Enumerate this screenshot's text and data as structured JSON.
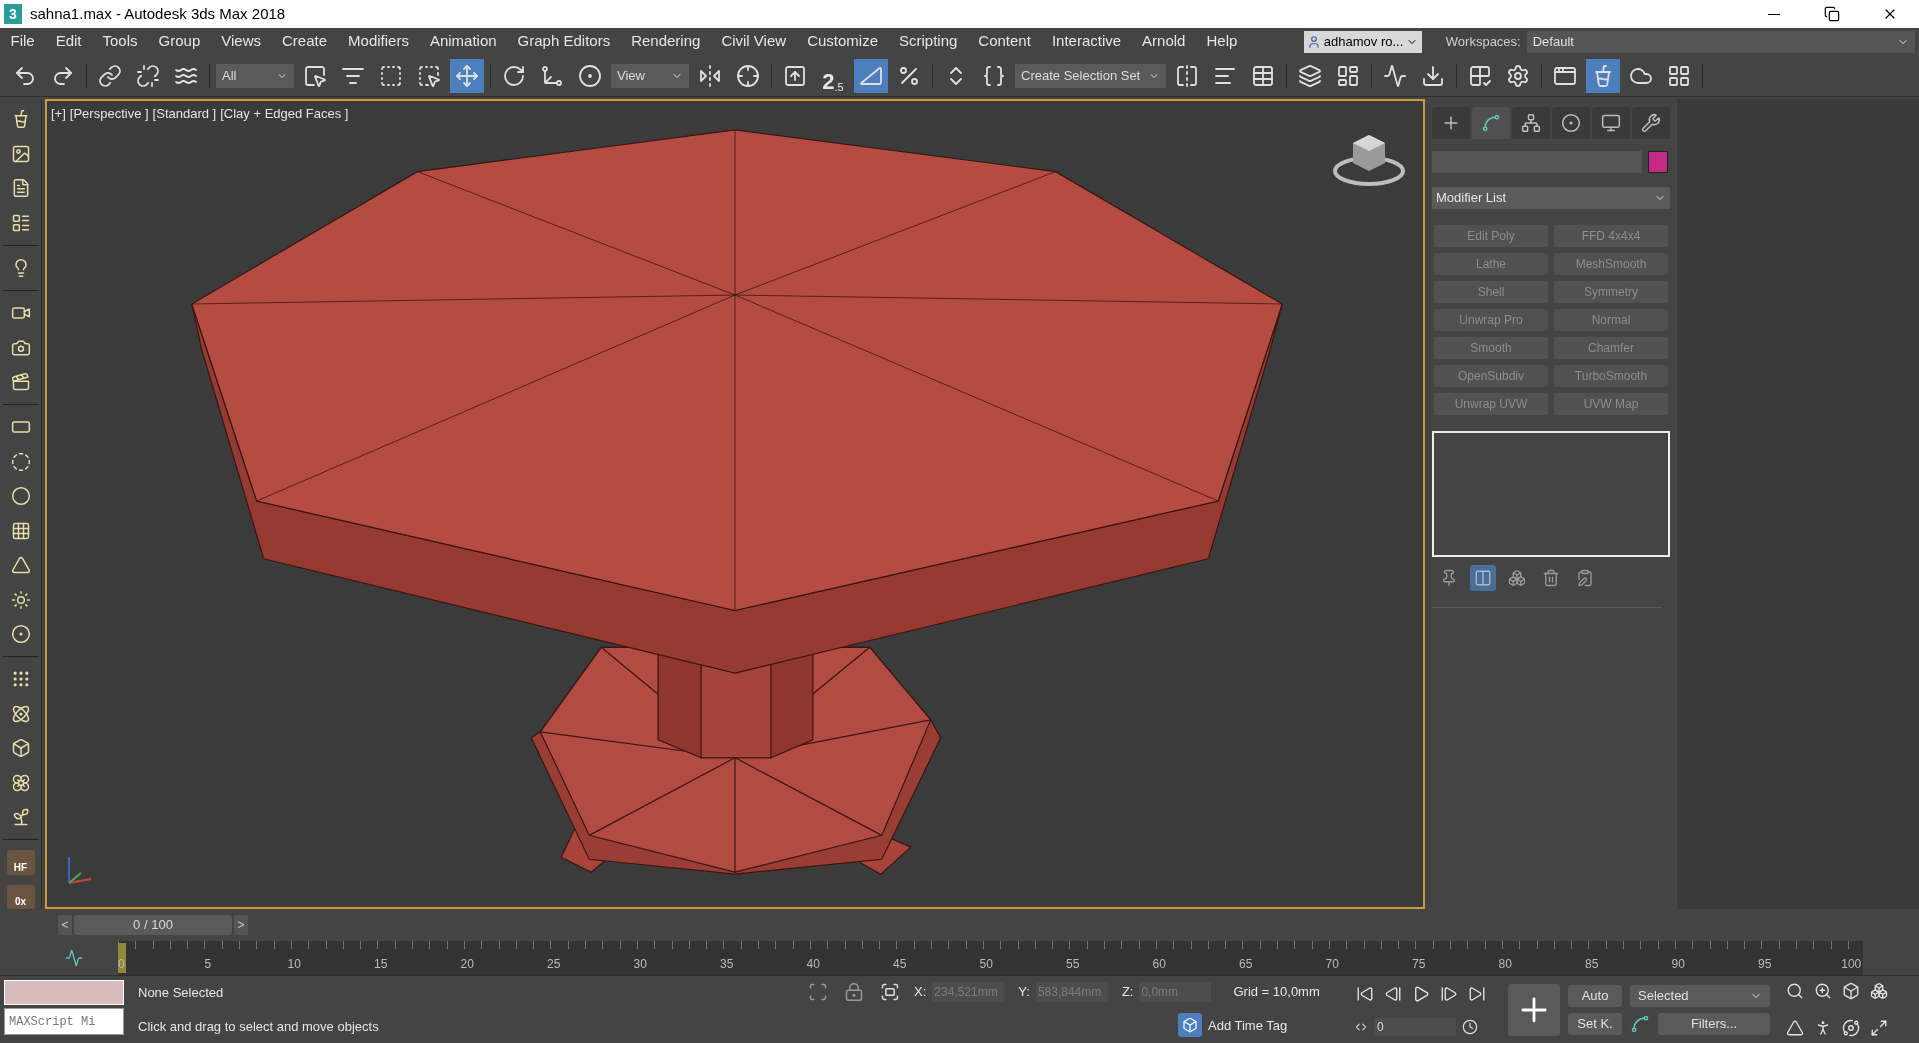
{
  "window": {
    "logo": "3",
    "title": "sahna1.max - Autodesk 3ds Max 2018"
  },
  "menu": [
    "File",
    "Edit",
    "Tools",
    "Group",
    "Views",
    "Create",
    "Modifiers",
    "Animation",
    "Graph Editors",
    "Rendering",
    "Civil View",
    "Customize",
    "Scripting",
    "Content",
    "Interactive",
    "Arnold",
    "Help"
  ],
  "user": {
    "name": "adhamov ro..."
  },
  "workspaces": {
    "label": "Workspaces:",
    "value": "Default"
  },
  "main_toolbar": [
    {
      "kind": "button",
      "selected": false
    },
    {
      "kind": "button",
      "selected": false
    },
    {
      "kind": "button",
      "selected": false
    },
    {
      "kind": "button",
      "selected": false
    },
    {
      "kind": "button",
      "selected": false
    },
    {
      "kind": "dropdown",
      "value": "All"
    },
    {
      "kind": "button",
      "selected": false
    },
    {
      "kind": "button",
      "selected": false
    },
    {
      "kind": "button",
      "selected": false
    },
    {
      "kind": "button",
      "selected": false
    },
    {
      "kind": "button",
      "selected": true
    },
    {
      "kind": "button",
      "selected": false
    },
    {
      "kind": "button",
      "selected": false
    },
    {
      "kind": "button",
      "selected": false
    },
    {
      "kind": "dropdown",
      "value": "View"
    },
    {
      "kind": "button",
      "selected": false
    },
    {
      "kind": "button",
      "selected": false
    },
    {
      "kind": "button",
      "selected": false
    },
    {
      "kind": "snap",
      "label": "2",
      "sub": ".5",
      "selected": false
    },
    {
      "kind": "button",
      "selected": true
    },
    {
      "kind": "button",
      "selected": false
    },
    {
      "kind": "button",
      "selected": false
    },
    {
      "kind": "button",
      "selected": false
    },
    {
      "kind": "dropdown",
      "value": "Create Selection Set"
    },
    {
      "kind": "button",
      "selected": false
    },
    {
      "kind": "button",
      "selected": false
    },
    {
      "kind": "button",
      "selected": false
    },
    {
      "kind": "button",
      "selected": false
    },
    {
      "kind": "button",
      "selected": false
    },
    {
      "kind": "button",
      "selected": false
    },
    {
      "kind": "button",
      "selected": false
    },
    {
      "kind": "button",
      "selected": false
    },
    {
      "kind": "button",
      "selected": false
    },
    {
      "kind": "button",
      "selected": false
    },
    {
      "kind": "button",
      "selected": true
    },
    {
      "kind": "button",
      "selected": false
    },
    {
      "kind": "button",
      "selected": false
    }
  ],
  "left_toolbar": {
    "labels": [
      "HF",
      "0x"
    ]
  },
  "viewport": {
    "labels": [
      "[+]",
      "[Perspective ]",
      "[Standard ]",
      "[Clay + Edged Faces ]"
    ]
  },
  "command_panel": {
    "tabs": [
      {
        "selected": false
      },
      {
        "selected": true
      },
      {
        "selected": false
      },
      {
        "selected": false
      },
      {
        "selected": false
      },
      {
        "selected": false
      }
    ],
    "name_field": {
      "color": "#c52a86"
    },
    "modifier_list": "Modifier List",
    "modifier_buttons": [
      "Edit Poly",
      "FFD 4x4x4",
      "Lathe",
      "MeshSmooth",
      "Shell",
      "Symmetry",
      "Unwrap Pro",
      "Normal",
      "Smooth",
      "Chamfer",
      "OpenSubdiv",
      "TurboSmooth",
      "Unwrap UVW",
      "UVW Map"
    ],
    "stack_toolbar": [
      {
        "selected": false
      },
      {
        "selected": true
      },
      {
        "selected": false
      },
      {
        "selected": false
      },
      {
        "selected": false
      }
    ]
  },
  "timeline": {
    "prev": "<",
    "position": "0 / 100",
    "next": ">",
    "level": 0,
    "ticks": [
      "0",
      "5",
      "10",
      "15",
      "20",
      "25",
      "30",
      "35",
      "40",
      "45",
      "50",
      "55",
      "60",
      "65",
      "70",
      "75",
      "80",
      "85",
      "90",
      "95",
      "100"
    ]
  },
  "status": {
    "maxscript": "MAXScript Mi",
    "selection": "None Selected",
    "prompt": "Click and drag to select and move objects",
    "coords": [
      {
        "label": "X:",
        "value": "234,521mm",
        "disabled": true
      },
      {
        "label": "Y:",
        "value": "583,844mm",
        "disabled": true
      },
      {
        "label": "Z:",
        "value": "0,0mm",
        "disabled": true
      }
    ],
    "grid": "Grid = 10,0mm",
    "time_tag": "Add Time Tag"
  },
  "animation": {
    "frame": "0",
    "auto": "Auto",
    "key_filter": "Selected",
    "set_key": "Set K.",
    "filters": "Filters..."
  }
}
